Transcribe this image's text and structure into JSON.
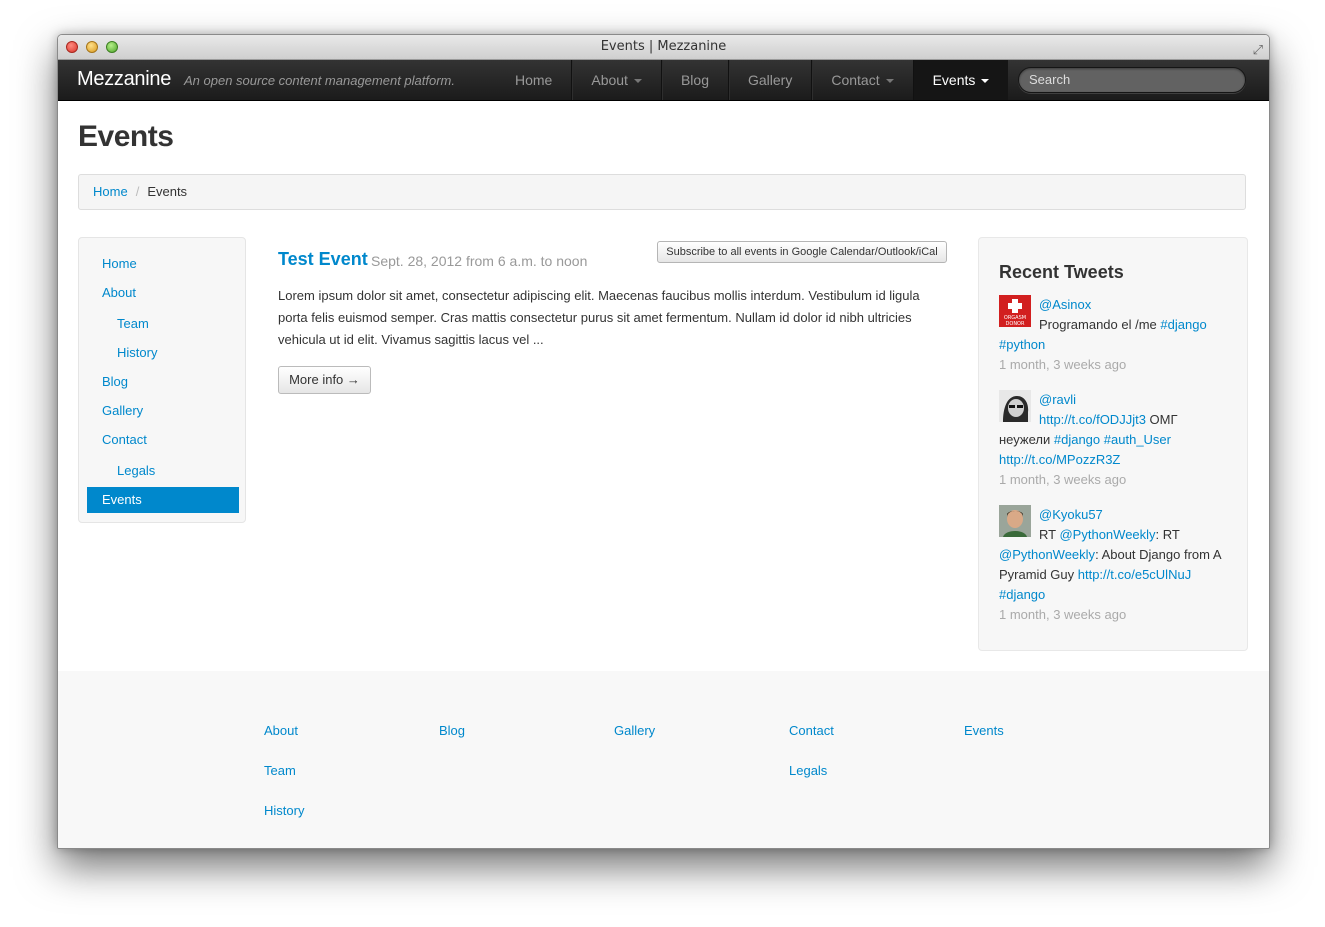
{
  "window": {
    "title": "Events | Mezzanine"
  },
  "navbar": {
    "brand": "Mezzanine",
    "tagline": "An open source content management platform.",
    "items": [
      {
        "label": "Home"
      },
      {
        "label": "About"
      },
      {
        "label": "Blog"
      },
      {
        "label": "Gallery"
      },
      {
        "label": "Contact"
      },
      {
        "label": "Events"
      }
    ],
    "search_placeholder": "Search"
  },
  "page": {
    "title": "Events"
  },
  "breadcrumb": {
    "home": "Home",
    "separator": "/",
    "current": "Events"
  },
  "sidebar": {
    "items": [
      {
        "label": "Home"
      },
      {
        "label": "About"
      },
      {
        "label": "Team"
      },
      {
        "label": "History"
      },
      {
        "label": "Blog"
      },
      {
        "label": "Gallery"
      },
      {
        "label": "Contact"
      },
      {
        "label": "Legals"
      },
      {
        "label": "Events"
      }
    ]
  },
  "event": {
    "title": "Test Event",
    "date": "Sept. 28, 2012 from 6 a.m. to noon",
    "subscribe_label": "Subscribe to all events in Google Calendar/Outlook/iCal",
    "body": "Lorem ipsum dolor sit amet, consectetur adipiscing elit. Maecenas faucibus mollis interdum. Vestibulum id ligula porta felis euismod semper. Cras mattis consectetur purus sit amet fermentum. Nullam id dolor id nibh ultricies vehicula ut id elit. Vivamus sagittis lacus vel ...",
    "more_label": "More info →"
  },
  "tweets": {
    "title": "Recent Tweets",
    "avatar_text": [
      "ORGASM",
      "DONOR"
    ],
    "items": [
      {
        "user": "@Asinox",
        "text": "Programando el /me",
        "tag1": "#django",
        "tag2": "#python",
        "time": "1 month, 3 weeks ago"
      },
      {
        "user": "@ravli",
        "link1": "http://t.co/fODJJjt3",
        "text1": " ОМГ",
        "text2": "неужели ",
        "tag1": "#django",
        "tag2": "#auth_User",
        "link2": "http://t.co/MPozzR3Z",
        "time": "1 month, 3 weeks ago"
      },
      {
        "user": "@Kyoku57",
        "rt1": "RT ",
        "mention1": "@PythonWeekly",
        "rt2": ": RT",
        "mention2": "@PythonWeekly",
        "text": ": About Django from A",
        "text2": "Pyramid Guy ",
        "link": "http://t.co/e5cUlNuJ",
        "tag": "#django",
        "time": "1 month, 3 weeks ago"
      }
    ]
  },
  "footer": {
    "links": {
      "about": "About",
      "team": "Team",
      "history": "History",
      "blog": "Blog",
      "gallery": "Gallery",
      "contact": "Contact",
      "legals": "Legals",
      "events": "Events"
    }
  }
}
